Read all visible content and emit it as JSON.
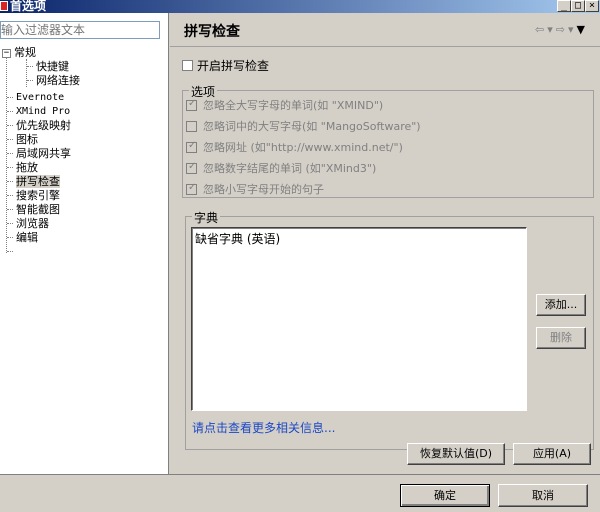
{
  "window": {
    "title": "首选项"
  },
  "filter": {
    "placeholder": "输入过滤器文本"
  },
  "tree": {
    "items": [
      {
        "label": "常规"
      },
      {
        "label": "快捷键"
      },
      {
        "label": "网络连接"
      },
      {
        "label": "Evernote"
      },
      {
        "label": "XMind Pro"
      },
      {
        "label": "优先级映射"
      },
      {
        "label": "图标"
      },
      {
        "label": "局域网共享"
      },
      {
        "label": "拖放"
      },
      {
        "label": "拼写检查"
      },
      {
        "label": "搜索引擎"
      },
      {
        "label": "智能截图"
      },
      {
        "label": "浏览器"
      },
      {
        "label": "编辑"
      }
    ],
    "selected": "拼写检查"
  },
  "page": {
    "title": "拼写检查",
    "enable_spell_check": {
      "label": "开启拼写检查",
      "checked": false
    },
    "options": {
      "legend": "选项",
      "items": [
        {
          "label": "忽略全大写字母的单词(如 \"XMIND\")",
          "checked": true
        },
        {
          "label": "忽略词中的大写字母(如 \"MangoSoftware\")",
          "checked": false
        },
        {
          "label": "忽略网址 (如\"http://www.xmind.net/\")",
          "checked": true
        },
        {
          "label": "忽略数字结尾的单词 (如\"XMind3\")",
          "checked": true
        },
        {
          "label": "忽略小写字母开始的句子",
          "checked": true
        }
      ]
    },
    "dictionary": {
      "legend": "字典",
      "items": [
        "缺省字典 (英语)"
      ],
      "add_button": "添加...",
      "remove_button": "删除"
    },
    "more_info_link": "请点击查看更多相关信息...",
    "restore_defaults_button": "恢复默认值(D)",
    "apply_button": "应用(A)"
  },
  "footer": {
    "ok_button": "确定",
    "cancel_button": "取消"
  },
  "colors": {
    "link": "#1d48c4",
    "title_bar": "#0a246a"
  }
}
